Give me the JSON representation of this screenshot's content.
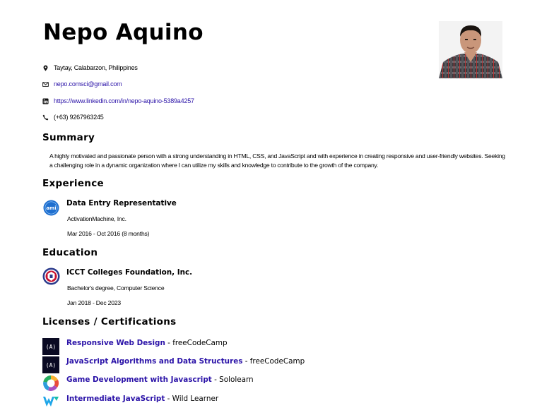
{
  "profile": {
    "name": "Nepo Aquino"
  },
  "contact": {
    "location": "Taytay, Calabarzon, Philippines",
    "email": "nepo.comsci@gmail.com",
    "linkedin": "https://www.linkedin.com/in/nepo-aquino-5389a4257",
    "phone": "(+63) 9267963245"
  },
  "summary": {
    "heading": "Summary",
    "text": "A highly motivated and passionate person with a strong understanding in HTML, CSS, and JavaScript and with experience in creating responsive and user-friendly websites. Seeking a challenging role in a dynamic organization where I can utilize my skills and knowledge to contribute to the growth of the company."
  },
  "experience": {
    "heading": "Experience",
    "logo_text": "ami",
    "title": "Data Entry Representative",
    "company": "ActivationMachine, Inc.",
    "dates": "Mar 2016 - Oct 2016 (8 months)"
  },
  "education": {
    "heading": "Education",
    "school": "ICCT Colleges Foundation, Inc.",
    "degree": "Bachelor's degree, Computer Science",
    "dates": "Jan 2018 - Dec 2023"
  },
  "certifications": {
    "heading": "Licenses / Certifications",
    "items": [
      {
        "title": "Responsive Web Design",
        "source": " - freeCodeCamp",
        "logo_text": "(A)"
      },
      {
        "title": "JavaScript Algorithms and Data Structures",
        "source": " - freeCodeCamp",
        "logo_text": "(A)"
      },
      {
        "title": "Game Development with Javascript",
        "source": " - Sololearn"
      },
      {
        "title": "Intermediate JavaScript",
        "source": " - Wild Learner"
      }
    ]
  },
  "colors": {
    "link": "#2b13a8",
    "fcc_dark": "#0a0a23",
    "ami_blue": "#1f6fcf"
  }
}
